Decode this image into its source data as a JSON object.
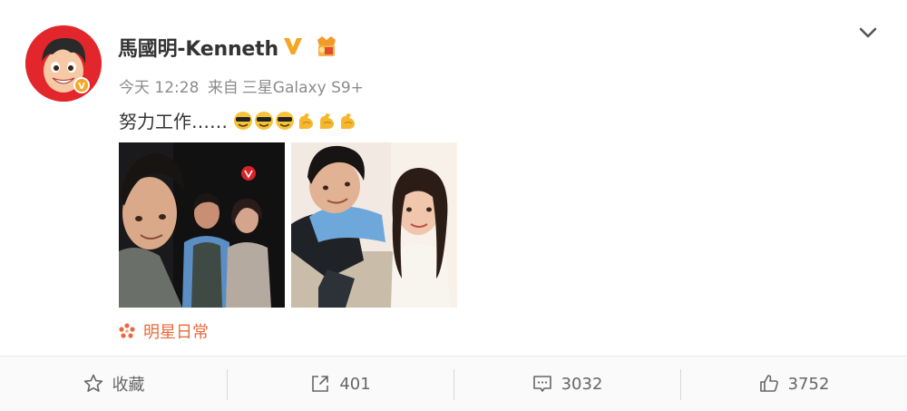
{
  "post": {
    "username": "馬國明-Kenneth",
    "meta": {
      "time": "今天 12:28",
      "source_prefix": "来自",
      "device": "三星Galaxy S9+"
    },
    "content_text": "努力工作……",
    "emojis": [
      "cool-face",
      "cool-face",
      "cool-face",
      "flexed-biceps",
      "flexed-biceps",
      "flexed-biceps"
    ],
    "topic": "明星日常",
    "colors": {
      "topic": "#e86a3c",
      "verified": "#f5a623",
      "avatar_bg": "#e3262b"
    }
  },
  "actions": {
    "favorite_label": "收藏",
    "repost_count": "401",
    "comment_count": "3032",
    "like_count": "3752"
  }
}
